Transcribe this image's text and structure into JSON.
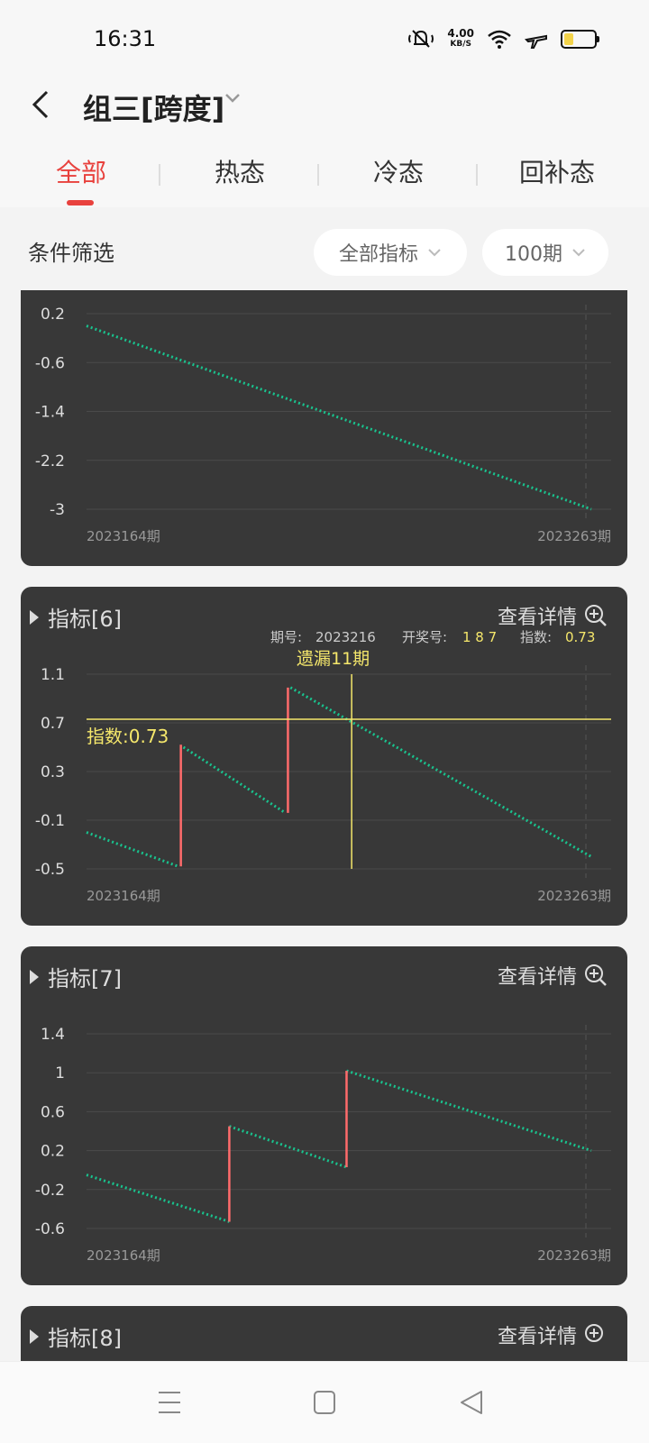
{
  "status_bar": {
    "time": "16:31",
    "net_speed": "4.00",
    "net_unit": "KB/S",
    "icons": [
      "mute-icon",
      "wifi-icon",
      "airplane-icon",
      "battery-icon"
    ]
  },
  "header": {
    "title": "组三[跨度]"
  },
  "tabs": [
    {
      "label": "全部"
    },
    {
      "label": "热态"
    },
    {
      "label": "冷态"
    },
    {
      "label": "回补态"
    }
  ],
  "filter": {
    "label": "条件筛选",
    "indicator": "全部指标",
    "period": "100期"
  },
  "cards": [
    {
      "title": "",
      "detail_label": "",
      "start_label": "2023164期",
      "end_label": "2023263期",
      "y_ticks": [
        "0.2",
        "-0.6",
        "-1.4",
        "-2.2",
        "-3"
      ],
      "segments": [
        {
          "x1": 0,
          "y1": 0.0,
          "x2": 99,
          "y2": -3.0
        }
      ],
      "jumps": []
    },
    {
      "title": "指标[6]",
      "detail_label": "查看详情",
      "info": {
        "period_key": "期号:",
        "period": "2023216",
        "draw_key": "开奖号:",
        "draw": "1 8 7",
        "index_key": "指数:",
        "index": "0.73"
      },
      "miss_label": "遗漏11期",
      "index_tag": "指数:0.73",
      "start_label": "2023164期",
      "end_label": "2023263期",
      "y_ticks": [
        "1.1",
        "0.7",
        "0.3",
        "-0.1",
        "-0.5"
      ],
      "crosshair": {
        "x": 52,
        "y": 0.73
      },
      "segments": [
        {
          "x1": 0,
          "y1": -0.2,
          "x2": 18,
          "y2": -0.48
        },
        {
          "x1": 19,
          "y1": 0.5,
          "x2": 39,
          "y2": -0.04
        },
        {
          "x1": 40,
          "y1": 0.99,
          "x2": 99,
          "y2": -0.4
        }
      ],
      "jumps": [
        {
          "x": 18.5,
          "y1": -0.48,
          "y2": 0.52
        },
        {
          "x": 39.5,
          "y1": -0.04,
          "y2": 0.99
        }
      ]
    },
    {
      "title": "指标[7]",
      "detail_label": "查看详情",
      "start_label": "2023164期",
      "end_label": "2023263期",
      "y_ticks": [
        "1.4",
        "1",
        "0.6",
        "0.2",
        "-0.2",
        "-0.6"
      ],
      "segments": [
        {
          "x1": 0,
          "y1": -0.05,
          "x2": 28,
          "y2": -0.53
        },
        {
          "x1": 28,
          "y1": 0.45,
          "x2": 51,
          "y2": 0.03
        },
        {
          "x1": 51,
          "y1": 1.02,
          "x2": 99,
          "y2": 0.2
        }
      ],
      "jumps": [
        {
          "x": 28,
          "y1": -0.53,
          "y2": 0.45
        },
        {
          "x": 51,
          "y1": 0.03,
          "y2": 1.02
        }
      ]
    },
    {
      "title": "指标[8]",
      "detail_label": "查看详情"
    }
  ],
  "colors": {
    "accent": "#e8413d",
    "line": "#19c38e",
    "jump": "#ff6b6b",
    "crosshair": "#f5e76b",
    "card_bg": "#383838"
  }
}
